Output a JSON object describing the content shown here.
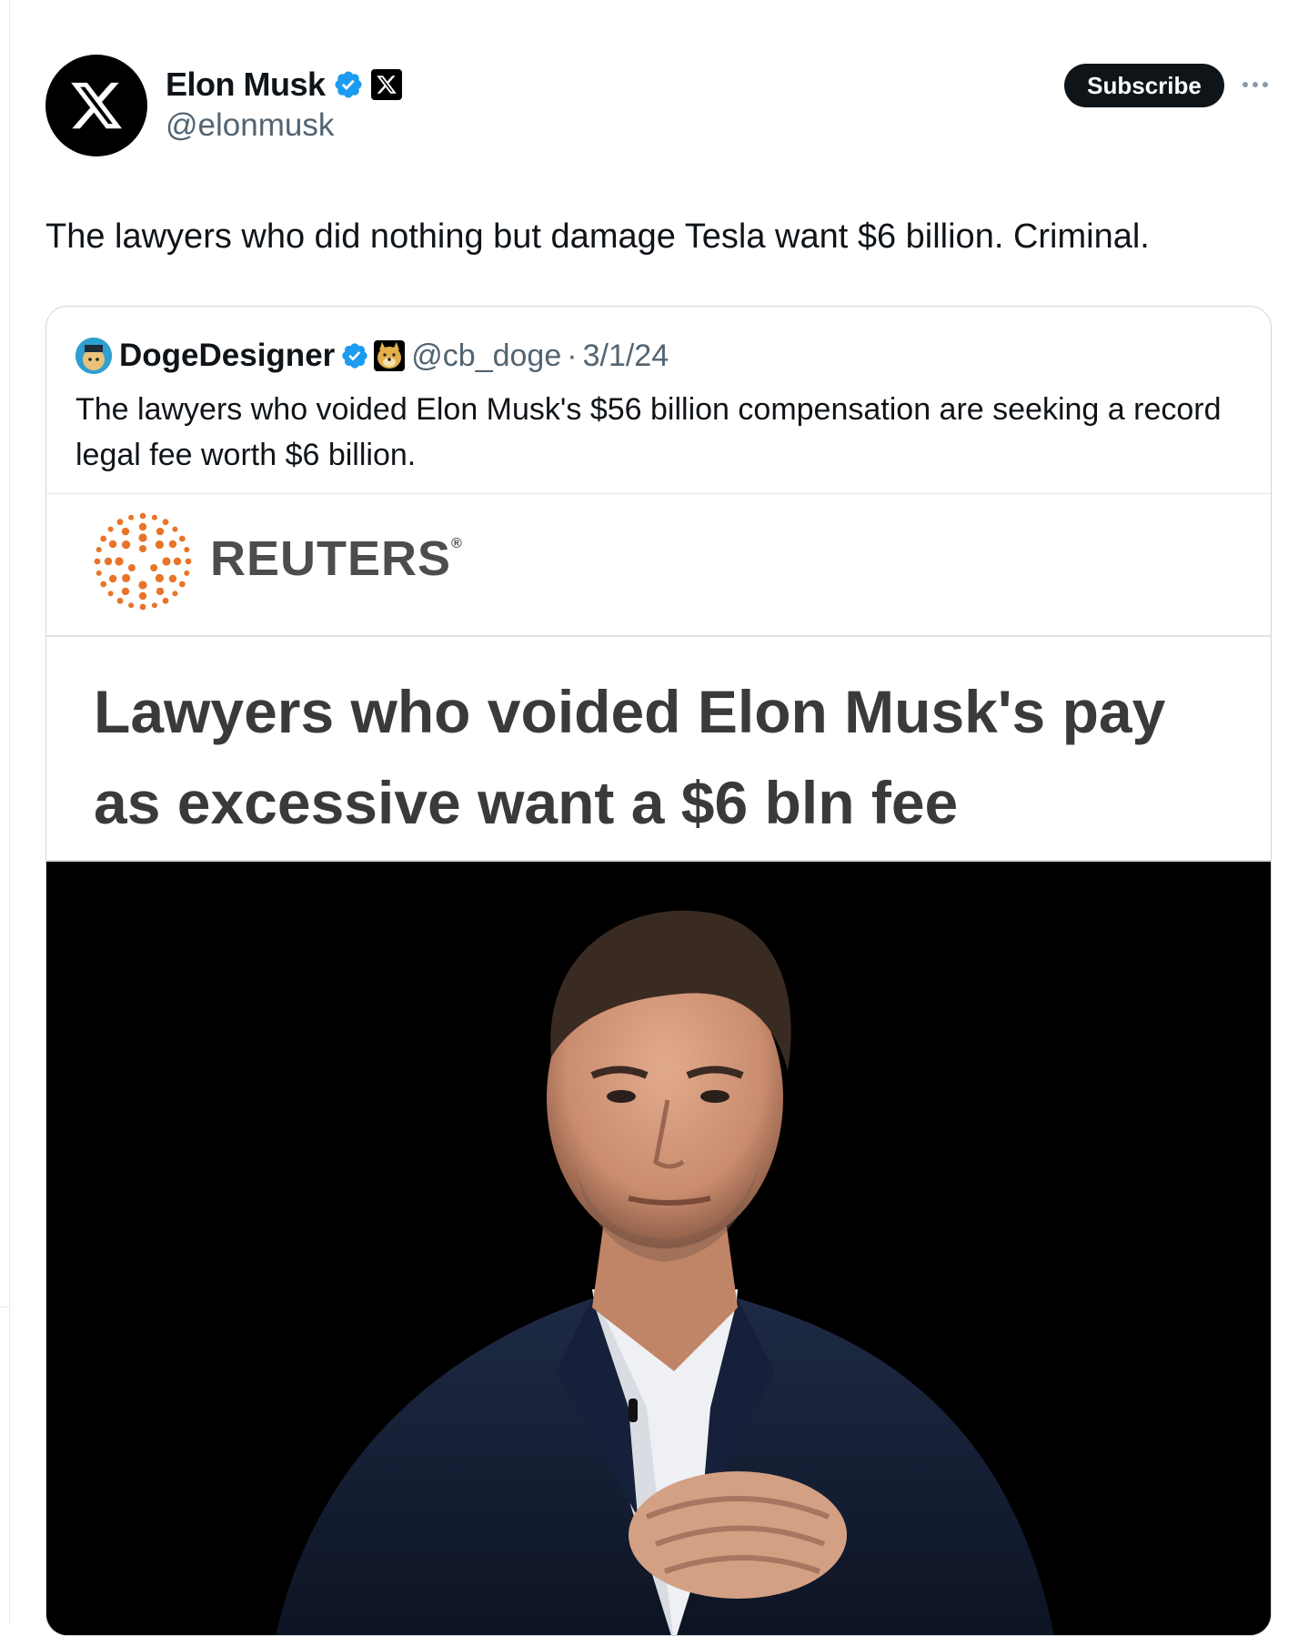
{
  "author": {
    "name": "Elon Musk",
    "handle": "@elonmusk"
  },
  "actions": {
    "subscribe_label": "Subscribe"
  },
  "tweet": {
    "text": "The lawyers who did nothing but damage Tesla want $6 billion. Criminal."
  },
  "quoted": {
    "name": "DogeDesigner",
    "handle": "@cb_doge",
    "separator": "·",
    "date": "3/1/24",
    "text": "The lawyers who voided Elon Musk's $56 billion compensation are seeking a record legal fee worth $6 billion."
  },
  "media": {
    "source": "REUTERS",
    "source_mark": "®",
    "headline": "Lawyers who voided Elon Musk's pay as excessive want a $6 bln fee"
  },
  "colors": {
    "verified_blue": "#1d9bf0",
    "subscribe_bg": "#0f1419",
    "handle_gray": "#536471",
    "reuters_orange": "#e8742a"
  },
  "icons": {
    "avatar": "x-logo-icon",
    "verified": "verified-badge-icon",
    "affiliate": "x-affiliate-badge-icon",
    "more": "more-dots-icon",
    "doge": "doge-badge-icon"
  }
}
